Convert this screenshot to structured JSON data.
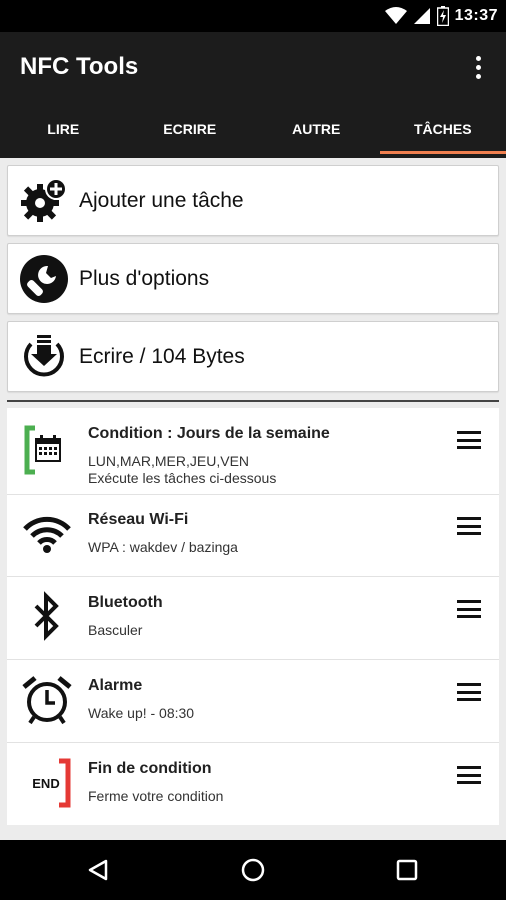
{
  "status_bar": {
    "time": "13:37"
  },
  "app_bar": {
    "title": "NFC Tools"
  },
  "tabs": [
    {
      "label": "LIRE",
      "active": false
    },
    {
      "label": "ECRIRE",
      "active": false
    },
    {
      "label": "AUTRE",
      "active": false
    },
    {
      "label": "TÂCHES",
      "active": true
    }
  ],
  "actions": {
    "add_task": "Ajouter une tâche",
    "more_options": "Plus d'options",
    "write": "Ecrire / 104 Bytes"
  },
  "tasks": [
    {
      "icon": "calendar-condition-icon",
      "title": "Condition : Jours de la semaine",
      "sub1": "LUN,MAR,MER,JEU,VEN",
      "sub2": "Exécute les tâches ci-dessous"
    },
    {
      "icon": "wifi-icon",
      "title": "Réseau Wi-Fi",
      "sub1": "WPA : wakdev / bazinga"
    },
    {
      "icon": "bluetooth-icon",
      "title": "Bluetooth",
      "sub1": "Basculer"
    },
    {
      "icon": "alarm-clock-icon",
      "title": "Alarme",
      "sub1": "Wake up! - 08:30"
    },
    {
      "icon": "end-condition-icon",
      "icon_text": "END",
      "title": "Fin de condition",
      "sub1": "Ferme votre condition"
    }
  ],
  "colors": {
    "accent": "#f07f4f",
    "condition_green": "#4caf50",
    "end_red": "#e53935",
    "toolbar": "#1c1c1c"
  }
}
